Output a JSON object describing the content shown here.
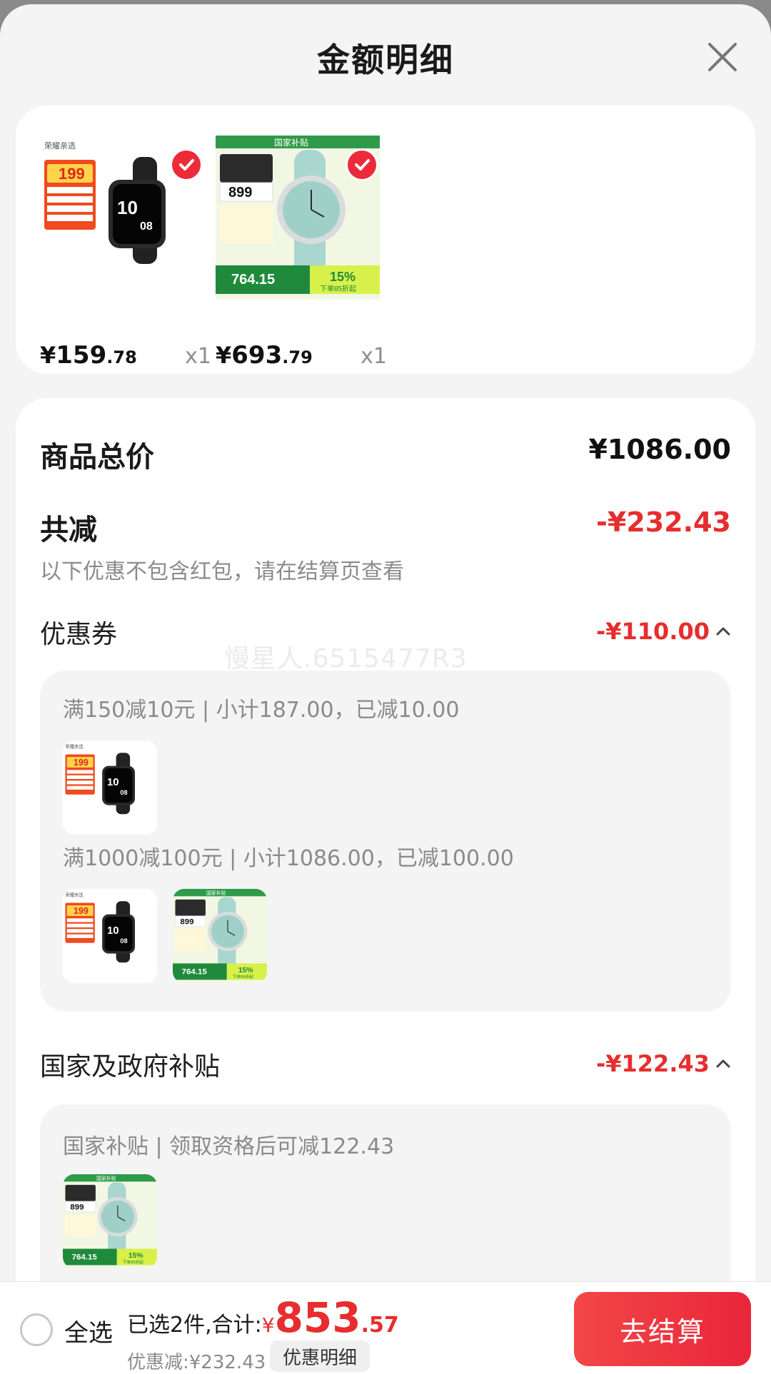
{
  "header": {
    "title": "金额明细"
  },
  "products": [
    {
      "price_currency": "¥",
      "price_int": "159",
      "price_dec": ".78",
      "qty": "x1",
      "image": "black-smartwatch",
      "image_text": "荣耀亲选",
      "badge_price": "199"
    },
    {
      "price_currency": "¥",
      "price_int": "693",
      "price_dec": ".79",
      "qty": "x1",
      "image": "xiaomi-watch",
      "image_banner": "国家补贴",
      "image_price": "899",
      "image_sub_price": "764.15",
      "image_pct": "15%",
      "image_tag": "下单85折起"
    }
  ],
  "summary": {
    "total_label": "商品总价",
    "total_value": "¥1086.00",
    "reduce_label": "共减",
    "reduce_value": "-¥232.43",
    "reduce_note": "以下优惠不包含红包，请在结算页查看",
    "coupon_label": "优惠券",
    "coupon_value": "-¥110.00",
    "coupon_items": [
      "满150减10元 | 小计187.00，已减10.00",
      "满1000减100元 | 小计1086.00，已减100.00"
    ],
    "subsidy_label": "国家及政府补贴",
    "subsidy_value": "-¥122.43",
    "subsidy_items": [
      "国家补贴 | 领取资格后可减122.43"
    ],
    "watermark": "慢星人.6515477R3"
  },
  "bottom_bar": {
    "select_all": "全选",
    "selected_text": "已选2件,合计:",
    "total_currency": "¥",
    "total_int": "853",
    "total_dec": ".57",
    "discount_text": "优惠减:¥232.43",
    "detail_button": "优惠明细",
    "checkout_button": "去结算"
  },
  "colors": {
    "accent_red": "#e72d2d",
    "background": "#f4f4f4",
    "card": "#ffffff"
  }
}
